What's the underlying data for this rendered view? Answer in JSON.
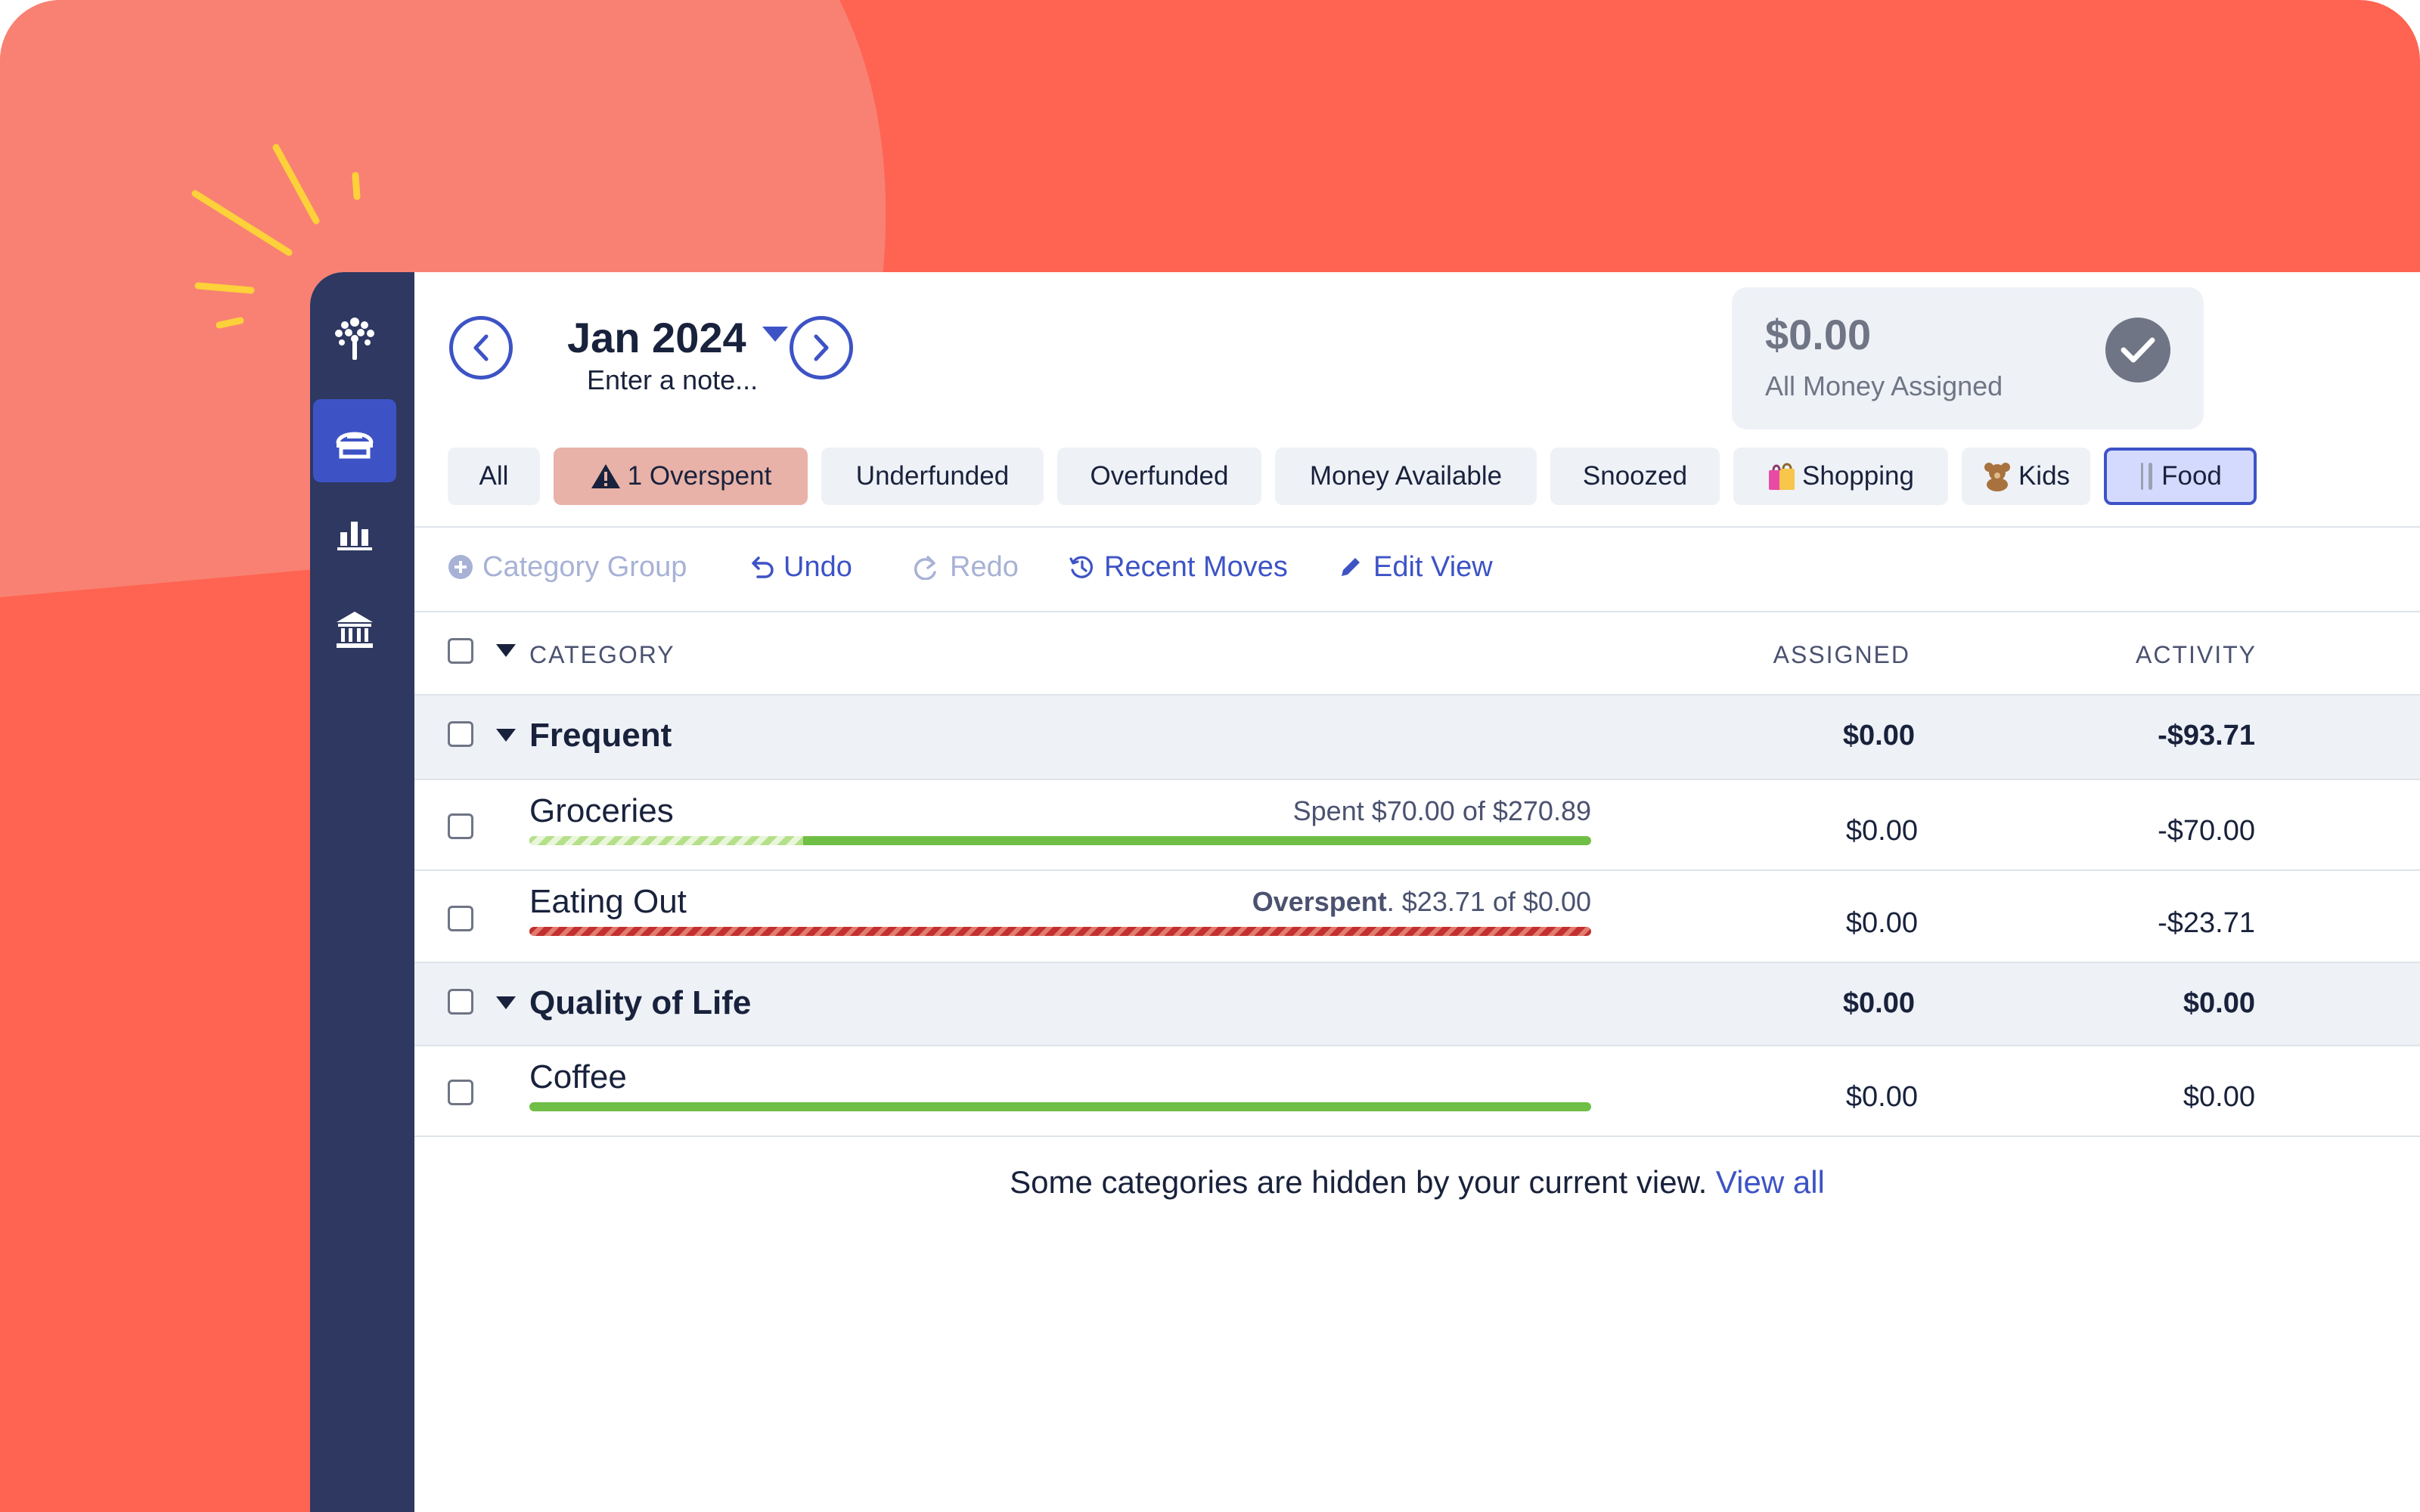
{
  "colors": {
    "background": "#fe6451",
    "sidebar": "#2e3861",
    "accent": "#3d53c5",
    "funded_green": "#6fbe45",
    "overspent_red": "#c2302f"
  },
  "sidebar": {
    "items": [
      {
        "icon": "tree-logo-icon",
        "active": false
      },
      {
        "icon": "budget-icon",
        "active": true
      },
      {
        "icon": "reports-icon",
        "active": false
      },
      {
        "icon": "accounts-bank-icon",
        "active": false
      }
    ]
  },
  "header": {
    "month": "Jan 2024",
    "note_placeholder": "Enter a note..."
  },
  "assigned_card": {
    "amount": "$0.00",
    "label": "All Money Assigned"
  },
  "filters": [
    {
      "label": "All"
    },
    {
      "label": "1 Overspent",
      "icon": "warning-icon",
      "state": "warning"
    },
    {
      "label": "Underfunded"
    },
    {
      "label": "Overfunded"
    },
    {
      "label": "Money Available"
    },
    {
      "label": "Snoozed"
    },
    {
      "label": "Shopping",
      "icon": "shopping-bags-icon"
    },
    {
      "label": "Kids",
      "icon": "teddy-bear-icon"
    },
    {
      "label": "Food",
      "icon": "fork-knife-icon",
      "state": "selected"
    }
  ],
  "toolbar": {
    "category_group": "Category Group",
    "undo": "Undo",
    "redo": "Redo",
    "recent_moves": "Recent Moves",
    "edit_view": "Edit View"
  },
  "columns": {
    "category": "CATEGORY",
    "assigned": "ASSIGNED",
    "activity": "ACTIVITY"
  },
  "groups": [
    {
      "name": "Frequent",
      "assigned": "$0.00",
      "activity": "-$93.71",
      "categories": [
        {
          "name": "Groceries",
          "progress_label": "Spent $70.00 of $270.89",
          "assigned": "$0.00",
          "activity": "-$70.00",
          "spent_fraction": 0.258,
          "status": "funded"
        },
        {
          "name": "Eating Out",
          "progress_label_strong": "Overspent",
          "progress_label": ". $23.71 of $0.00",
          "assigned": "$0.00",
          "activity": "-$23.71",
          "spent_fraction": 1.0,
          "status": "overspent"
        }
      ]
    },
    {
      "name": "Quality of Life",
      "assigned": "$0.00",
      "activity": "$0.00",
      "categories": [
        {
          "name": "Coffee",
          "assigned": "$0.00",
          "activity": "$0.00",
          "spent_fraction": 0,
          "status": "funded"
        }
      ]
    }
  ],
  "footer": {
    "text": "Some categories are hidden by your current view.",
    "link": "View all"
  }
}
